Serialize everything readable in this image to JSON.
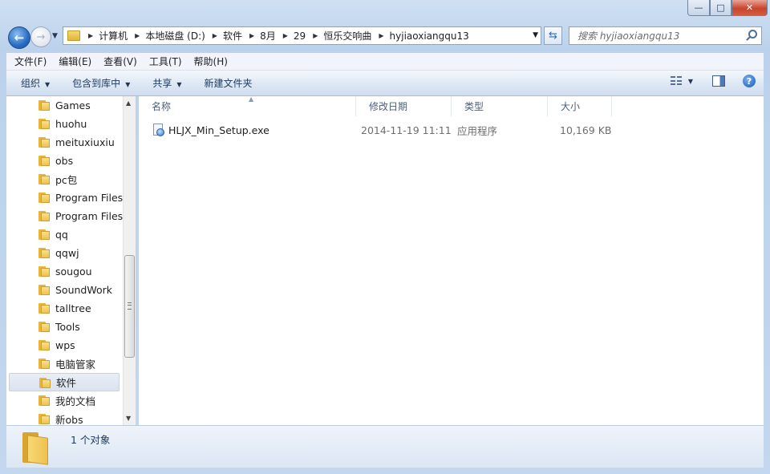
{
  "window": {
    "min_icon": "minimize-icon",
    "max_icon": "maximize-icon",
    "close_icon": "close-icon"
  },
  "address": {
    "crumbs": [
      "计算机",
      "本地磁盘 (D:)",
      "软件",
      "8月",
      "29",
      "恒乐交响曲",
      "hyjiaoxiangqu13"
    ]
  },
  "search": {
    "placeholder": "搜索 hyjiaoxiangqu13"
  },
  "menu": {
    "file": "文件(F)",
    "edit": "编辑(E)",
    "view": "查看(V)",
    "tools": "工具(T)",
    "help": "帮助(H)"
  },
  "toolbar": {
    "organize": "组织",
    "include": "包含到库中",
    "share": "共享",
    "new_folder": "新建文件夹"
  },
  "tree": {
    "items": [
      "Games",
      "huohu",
      "meituxiuxiu",
      "obs",
      "pc包",
      "Program Files",
      "Program Files",
      "qq",
      "qqwj",
      "sougou",
      "SoundWork",
      "talltree",
      "Tools",
      "wps",
      "电脑管家",
      "软件",
      "我的文档",
      "新obs"
    ],
    "selected": "软件"
  },
  "columns": {
    "name": "名称",
    "date": "修改日期",
    "type": "类型",
    "size": "大小"
  },
  "files": [
    {
      "name": "HLJX_Min_Setup.exe",
      "date": "2014-11-19 11:11",
      "type": "应用程序",
      "size": "10,169 KB",
      "icon": "exe-file-icon"
    }
  ],
  "status": {
    "count_text": "1 个对象"
  }
}
